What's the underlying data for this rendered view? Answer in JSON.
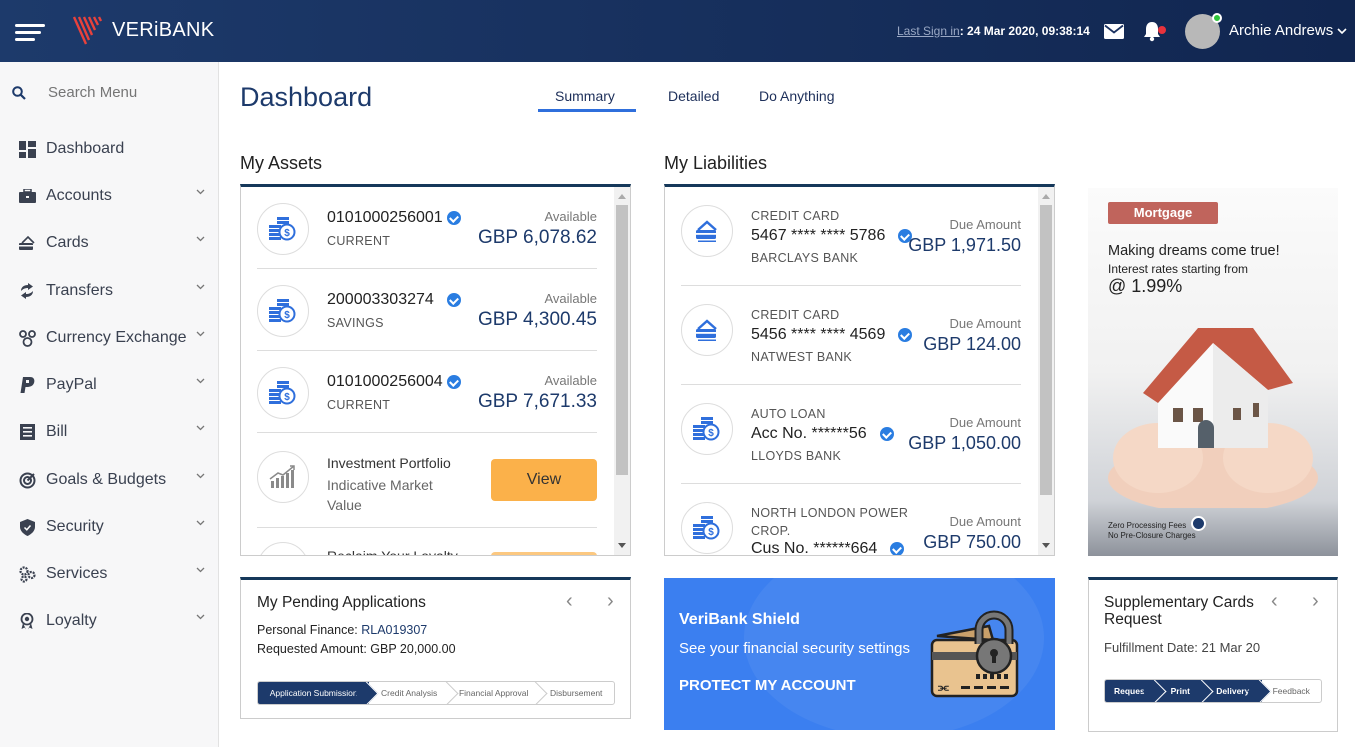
{
  "header": {
    "brand": "VERiBANK",
    "last_sign_in_label": "Last Sign in",
    "last_sign_in_value": ": 24 Mar 2020, 09:38:14",
    "user_name": "Archie Andrews"
  },
  "sidebar": {
    "search_placeholder": "Search Menu",
    "items": [
      {
        "label": "Dashboard",
        "icon": "dashboard-icon",
        "expandable": false
      },
      {
        "label": "Accounts",
        "icon": "briefcase-icon",
        "expandable": true
      },
      {
        "label": "Cards",
        "icon": "cards-icon",
        "expandable": true
      },
      {
        "label": "Transfers",
        "icon": "transfer-icon",
        "expandable": true
      },
      {
        "label": "Currency Exchange",
        "icon": "currency-exchange-icon",
        "expandable": true
      },
      {
        "label": "PayPal",
        "icon": "paypal-icon",
        "expandable": true
      },
      {
        "label": "Bill",
        "icon": "bill-icon",
        "expandable": true
      },
      {
        "label": "Goals & Budgets",
        "icon": "target-icon",
        "expandable": true
      },
      {
        "label": "Security",
        "icon": "shield-icon",
        "expandable": true
      },
      {
        "label": "Services",
        "icon": "gears-icon",
        "expandable": true
      },
      {
        "label": "Loyalty",
        "icon": "award-icon",
        "expandable": true
      }
    ]
  },
  "main": {
    "title": "Dashboard",
    "tabs": [
      {
        "label": "Summary",
        "active": true
      },
      {
        "label": "Detailed",
        "active": false
      },
      {
        "label": "Do Anything",
        "active": false
      }
    ]
  },
  "assets": {
    "title": "My Assets",
    "accounts": [
      {
        "number": "0101000256001",
        "type": "CURRENT",
        "label": "Available",
        "amount": "GBP 6,078.62"
      },
      {
        "number": "200003303274",
        "type": "SAVINGS",
        "label": "Available",
        "amount": "GBP 4,300.45"
      },
      {
        "number": "0101000256004",
        "type": "CURRENT",
        "label": "Available",
        "amount": "GBP 7,671.33"
      }
    ],
    "investment": {
      "title": "Investment Portfolio",
      "subtitle": "Indicative Market Value",
      "button": "View"
    },
    "partial_item": "Reclaim Your Loyalty"
  },
  "liabilities": {
    "title": "My Liabilities",
    "items": [
      {
        "category": "CREDIT CARD",
        "number": "5467 **** **** 5786",
        "bank": "BARCLAYS BANK",
        "label": "Due Amount",
        "amount": "GBP 1,971.50"
      },
      {
        "category": "CREDIT CARD",
        "number": "5456 **** **** 4569",
        "bank": "NATWEST BANK",
        "label": "Due Amount",
        "amount": "GBP 124.00"
      },
      {
        "category": "AUTO LOAN",
        "number": "Acc No. ******56",
        "bank": "LLOYDS BANK",
        "label": "Due Amount",
        "amount": "GBP 1,050.00"
      },
      {
        "category": "NORTH LONDON POWER",
        "category2": "CROP.",
        "number": "Cus No. ******664",
        "label": "Due Amount",
        "amount": "GBP 750.00"
      }
    ]
  },
  "banner": {
    "badge": "Mortgage",
    "line1": "Making dreams come true!",
    "line2": "Interest rates starting from",
    "line3": "@ 1.99%",
    "foot1": "Zero Processing Fees",
    "foot2": "No Pre-Closure Charges"
  },
  "pending": {
    "title": "My Pending Applications",
    "pf_label": "Personal Finance: ",
    "pf_value": "RLA019307",
    "amount_label": "Requested Amount: GBP 20,000.00",
    "steps": [
      {
        "label": "Application Submission",
        "done": true
      },
      {
        "label": "Credit Analysis",
        "done": false
      },
      {
        "label": "Financial Approval",
        "done": false
      },
      {
        "label": "Disbursement",
        "done": false
      }
    ]
  },
  "shield": {
    "title": "VeriBank Shield",
    "subtitle": "See your financial security settings",
    "cta": "PROTECT MY ACCOUNT"
  },
  "supplementary": {
    "title": "Supplementary Cards Request",
    "date": "Fulfillment Date: 21 Mar 20",
    "steps": [
      {
        "label": "Request",
        "done": true
      },
      {
        "label": "Print",
        "done": true
      },
      {
        "label": "Delivery",
        "done": true
      },
      {
        "label": "Feedback",
        "done": false
      }
    ]
  },
  "colors": {
    "navy": "#1d3a6b",
    "accent_blue": "#2f6fdc",
    "view_button": "#fbb14a",
    "mortgage_badge": "#c0645c",
    "shield_bg": "#3b7ff0"
  }
}
